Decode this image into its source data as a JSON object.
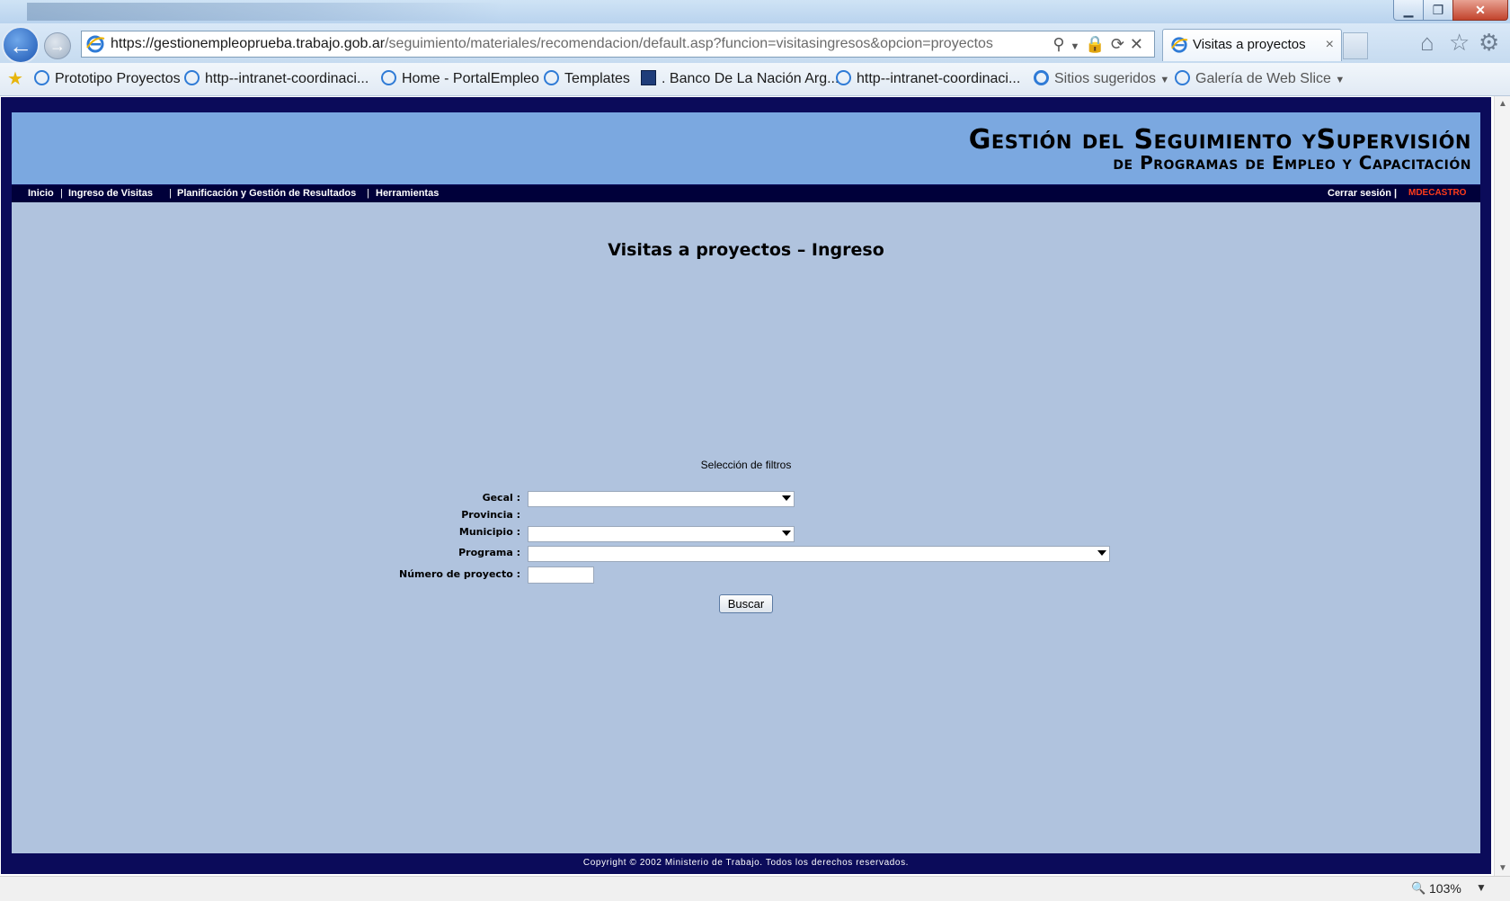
{
  "browser": {
    "address_url": "https://gestionempleoprueba.trabajo.gob.ar/seguimiento/materiales/recomendacion/default.asp?funcion=visitasingresos&opcion=proyectos",
    "url_host": "https://gestionempleoprueba.trabajo.gob.ar",
    "url_path": "/seguimiento/materiales/recomendacion/default.asp?funcion=visitasingresos&opcion=proyectos",
    "tab_title": "Visitas a proyectos",
    "tab_close": "×",
    "icons": [
      "back-arrow-icon",
      "forward-arrow-icon",
      "ie-logo-icon",
      "search-icon",
      "lock-icon",
      "refresh-icon",
      "stop-icon",
      "home-icon",
      "favorites-star-icon",
      "gear-icon"
    ],
    "zoom": "103%"
  },
  "favorites": [
    "Prototipo Proyectos",
    "http--intranet-coordinaci...",
    "Home - PortalEmpleo",
    "Templates",
    ". Banco De La Nación Arg...",
    "http--intranet-coordinaci...",
    "Sitios sugeridos",
    "Galería de Web Slice"
  ],
  "page": {
    "banner_line1": "Gestión del Seguimiento ySupervisión",
    "banner_line2": "de Programas de Empleo y Capacitación",
    "menu": {
      "inicio": "Inicio",
      "ingreso": "Ingreso de Visitas",
      "planificacion": "Planificación y Gestión de Resultados",
      "herramientas": "Herramientas",
      "separator": "|",
      "logout": "Cerrar sesión |",
      "user": "MDECASTRO"
    },
    "title": "Visitas a proyectos – Ingreso",
    "filters_heading": "Selección de filtros",
    "labels": {
      "gecal": "Gecal :",
      "provincia": "Provincia :",
      "municipio": "Municipio :",
      "programa": "Programa :",
      "numero": "Número de proyecto :"
    },
    "values": {
      "gecal": "",
      "municipio": "",
      "programa": "",
      "numero": ""
    },
    "search_button": "Buscar",
    "copyright": "Copyright © 2002 Ministerio de Trabajo. Todos los derechos reservados."
  },
  "colors": {
    "frame": "#0b0b5a",
    "banner": "#7ba8e0",
    "menubar": "#00003a",
    "content": "#b0c3de",
    "user": "#ff3b1a"
  }
}
